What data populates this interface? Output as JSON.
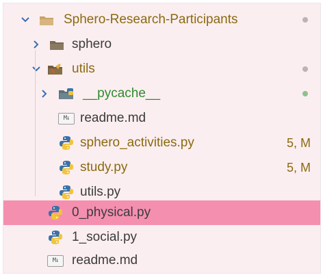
{
  "tree": {
    "root": {
      "label": "Sphero-Research-Participants"
    },
    "sphero_folder": {
      "label": "sphero"
    },
    "utils_folder": {
      "label": "utils"
    },
    "pycache_folder": {
      "label": "__pycache__"
    },
    "utils_readme": {
      "label": "readme.md",
      "icon_text": "M↓"
    },
    "sphero_activities": {
      "label": "sphero_activities.py",
      "status": "5, M"
    },
    "study": {
      "label": "study.py",
      "status": "5, M"
    },
    "utils_py": {
      "label": "utils.py"
    },
    "physical": {
      "label": "0_physical.py"
    },
    "social": {
      "label": "1_social.py"
    },
    "root_readme": {
      "label": "readme.md",
      "icon_text": "M↓"
    }
  },
  "colors": {
    "selected_row": "#f48fb0",
    "modified_text": "#8a6a10",
    "untracked_text": "#2e8b2e",
    "python_blue": "#3a72a8",
    "python_yellow": "#f2c43c",
    "folder_tan": "#c9a46a"
  },
  "icons": {
    "folder": "folder-icon",
    "python": "python-file-icon",
    "markdown": "markdown-file-icon",
    "chevron_down": "chevron-down-icon",
    "chevron_right": "chevron-right-icon"
  }
}
